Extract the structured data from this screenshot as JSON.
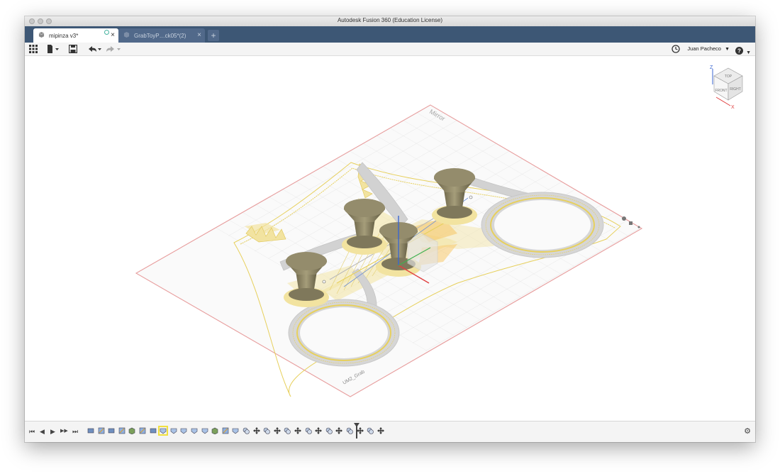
{
  "window": {
    "title": "Autodesk Fusion 360 (Education License)"
  },
  "tabs": [
    {
      "label": "mipinza v3*",
      "close": "×",
      "active": true
    },
    {
      "label": "GrabToyP…ck05*(2)",
      "close": "×",
      "active": false
    }
  ],
  "new_tab_label": "+",
  "toolbar": {
    "user_name": "Juan Pacheco",
    "dropdown_caret": "▼",
    "help_caret": "▼"
  },
  "viewcube": {
    "top": "TOP",
    "front": "FRONT",
    "right": "RIGHT",
    "axis_z": "Z",
    "axis_x": "X"
  },
  "canvas": {
    "sketch_label": "Mirror",
    "body_label": "UM2_Grab"
  },
  "timeline": {
    "controls": [
      "⏮",
      "◀",
      "▶",
      "▶▶",
      "⏭"
    ],
    "features": [
      "plane",
      "sketch",
      "plane",
      "sketch",
      "extrude",
      "sketch",
      "plane",
      "shell",
      "shell",
      "shell",
      "shell",
      "shell",
      "extrude",
      "sketch",
      "shell",
      "combine",
      "move",
      "combine",
      "move",
      "combine",
      "move",
      "combine",
      "move",
      "combine",
      "move",
      "combine",
      "move",
      "combine",
      "move"
    ]
  },
  "colors": {
    "tabbar": "#3d5775",
    "accent": "#e7d05d",
    "plate": "#e8a0a0"
  }
}
